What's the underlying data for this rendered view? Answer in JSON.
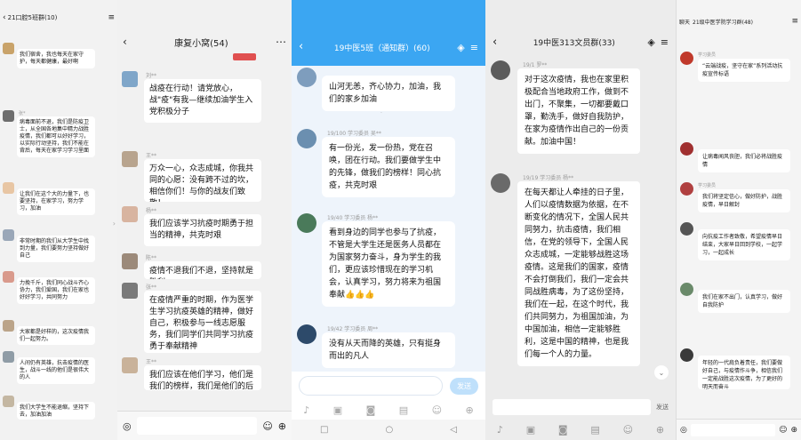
{
  "panel1": {
    "title": "21口腔5班群(10)",
    "messages": [
      {
        "name": "",
        "text": "我们宿舍，我也每天在家守护，每天都健康，最好啊",
        "av": "#c9a36a"
      },
      {
        "name": "张*",
        "text": "病毒面前不退，我们是防疫卫士，从全国各地集中精力战胜疫情，我们都可以好好学习，以实际行动坚持，我们不能在背后，每天在家学习学习里面",
        "av": "#6d6d6d"
      },
      {
        "name": "",
        "text": "让我们在这个大的力量下，也要坚持，在家学习，努力学习，加油",
        "av": "#e8c6a4"
      },
      {
        "name": "",
        "text": "非常时期的我们从大学生中找到力量，我们要努力坚持做好自己",
        "av": "#9aa7b8"
      },
      {
        "name": "",
        "text": "力挽千斤，我们同心战斗齐心协力，我们爱国，我们在家也好好学习，共同努力",
        "av": "#d99a8c"
      },
      {
        "name": "",
        "text": "大家都是好样的，这次疫情我们一起努力。",
        "av": "#bba489"
      },
      {
        "name": "",
        "text": "人间仍有英雄，抗击疫情的医生，战斗一线的他们是很伟大的人",
        "av": "#8f9ca6"
      },
      {
        "name": "",
        "text": "我们大学生不能退缩，坚持下去，加油加油",
        "av": "#c4b7a2"
      }
    ]
  },
  "panel2": {
    "title": "康复小窝(54)",
    "messages": [
      {
        "name": "刘**",
        "text": "战疫在行动！请党放心，战\"疫\"有我—继续加油学生入党积极分子",
        "av": "#7fa6c9",
        "img": true
      },
      {
        "name": "王**",
        "text": "万众一心，众志成城，你我共同的心愿：没有跨不过的坎，相信你们！与你的战友们致敬！",
        "av": "#b8a48e"
      },
      {
        "name": "杨**",
        "text": "我们应该学习抗疫时期勇于担当的精神，共克时艰",
        "av": "#d8b4a0"
      },
      {
        "name": "陈**",
        "text": "疫情不退我们不退，坚持就是胜利",
        "av": "#9c8a7a"
      },
      {
        "name": "张**",
        "text": "在疫情严重的时期，作为医学生学习抗疫英雄的精神，做好自己，积极参与一线志愿服务，我们同学们共同学习抗疫勇于奉献精神",
        "av": "#7a7a7a"
      },
      {
        "name": "王**",
        "text": "我们应该在他们学习，他们是我们的榜样，我们是他们的后备军😊😊",
        "av": "#c9b29a"
      }
    ],
    "input_placeholder": ""
  },
  "panel3": {
    "title": "19中医5班（通知群）(60)",
    "messages": [
      {
        "name": "",
        "text": "山河无恙，齐心协力，加油，我们的家乡加油",
        "av": "#7e9dbd"
      },
      {
        "name": "19/100 学习委员 吴**",
        "text": "有一份光，发一份热，党在召唤，团在行动。我们要做学生中的先锋，做我们的榜样！同心抗疫，共克时艰",
        "av": "#6b8fb0"
      },
      {
        "name": "19/40 学习委员 杨**",
        "text": "看到身边的同学也参与了抗疫，不管是大学生还是医务人员都在为国家努力奋斗，身为学生的我们，更应该珍惜现在的学习机会，认真学习，努力将来为祖国奉献👍👍👍",
        "av": "#4a7a5a"
      },
      {
        "name": "19/42 学习委员 周**",
        "text": "没有从天而降的英雄，只有挺身而出的凡人",
        "av": "#2d4a6a"
      }
    ],
    "input_placeholder": "",
    "send_label": "发送"
  },
  "panel4": {
    "title": "19中医313文员群(33)",
    "messages": [
      {
        "name": "19/1 罗**",
        "text": "对于这次疫情，我也在家里积极配合当地政府工作，做到不出门，不聚集，一切都要戴口罩，勤洗手，做好自我防护，在家为疫情作出自己的一份贡献。加油中国！",
        "av": "#5c5c5c"
      },
      {
        "name": "19/19 学习委员 杨**",
        "text": "在每天都让人牵挂的日子里，人们以疫情数据为依据，在不断变化的情况下，全国人民共同努力，抗击疫情，我们相信，在党的领导下，全国人民众志成城，一定能够战胜这场疫情。这是我们的国家，疫情不会打倒我们，我们一定会共同战胜病毒，为了这份坚持，我们在一起，在这个时代，我们共同努力，为祖国加油，为中国加油，相信一定能够胜利，这是中国的精神，也是我们每一个人的力量。",
        "av": "#6a6a6a"
      }
    ],
    "send_label": "发送"
  },
  "panel5": {
    "title": "21级中医学院学习群(48)",
    "header_label": "聊天",
    "messages": [
      {
        "name": "学习委员",
        "text": "“云端战疫，坚守在家”系列活动抗疫宣传标语",
        "av": "#c0392b",
        "img": true
      },
      {
        "name": "",
        "text": "让病毒闻风丧胆，我们必将战胜疫情",
        "av": "#a03030"
      },
      {
        "name": "学习委员",
        "text": "我们将坚定信心，做好防护，战胜疫情，早日解封",
        "av": "#b04040"
      },
      {
        "name": "",
        "text": "向抗疫工作者致敬，希望疫情早日结束，大家早日回到学校，一起学习，一起成长",
        "av": "#555"
      },
      {
        "name": "",
        "text": "我们在家不出门，认真学习，做好自我防护",
        "av": "#6a8a6a"
      },
      {
        "name": "",
        "text": "年轻的一代肩负着责任，我们要做好自己，与疫情作斗争，相信我们一定能战胜这次疫情，为了更好的明天而奋斗",
        "av": "#3a3a3a"
      }
    ]
  },
  "colors": {
    "blue_header": "#3ba6f2",
    "tag_blue": "#3a8ee6",
    "tag_green": "#46b34a",
    "bubble": "#ffffff"
  }
}
